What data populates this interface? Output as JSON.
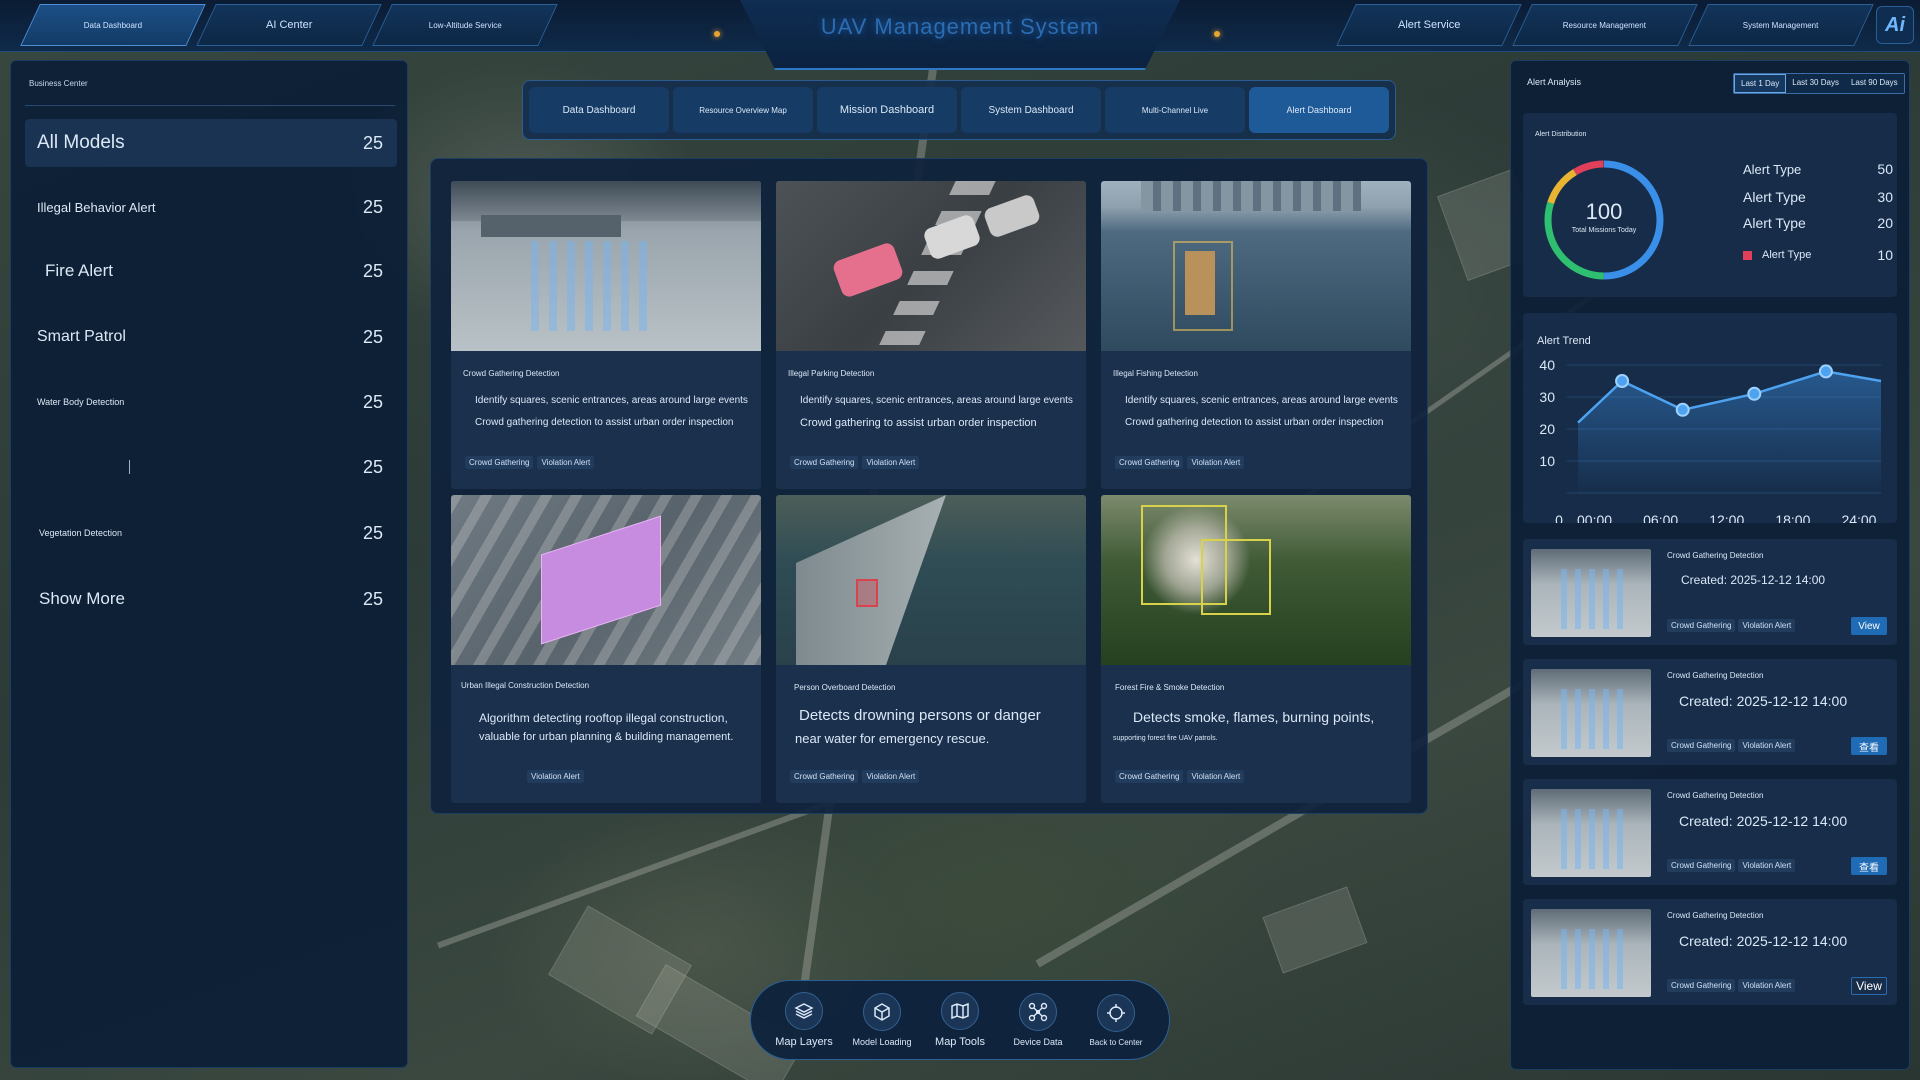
{
  "header": {
    "title": "UAV Management System",
    "left_tabs": [
      {
        "label": "Data Dashboard",
        "active": true
      },
      {
        "label": "AI Center",
        "active": false
      },
      {
        "label": "Low-Altitude Service",
        "active": false
      }
    ],
    "right_tabs": [
      {
        "label": "Alert Service",
        "active": false
      },
      {
        "label": "Resource Management",
        "active": false
      },
      {
        "label": "System Management",
        "active": false
      }
    ],
    "logo_text": "Ai"
  },
  "left_panel": {
    "title": "Business Center",
    "items": [
      {
        "label": "All Models",
        "count": "25"
      },
      {
        "label": "Illegal Behavior Alert",
        "count": "25"
      },
      {
        "label": "Fire Alert",
        "count": "25"
      },
      {
        "label": "Smart Patrol",
        "count": "25"
      },
      {
        "label": "Water Body Detection",
        "count": "25"
      },
      {
        "label": "",
        "count": "25"
      },
      {
        "label": "Vegetation Detection",
        "count": "25"
      },
      {
        "label": "Show More",
        "count": "25"
      }
    ]
  },
  "mid_tabs": [
    {
      "label": "Data Dashboard"
    },
    {
      "label": "Resource Overview Map"
    },
    {
      "label": "Mission Dashboard"
    },
    {
      "label": "System Dashboard"
    },
    {
      "label": "Multi-Channel Live"
    },
    {
      "label": "Alert Dashboard"
    }
  ],
  "cards": [
    {
      "title": "Crowd Gathering Detection",
      "d1": "Identify squares, scenic entrances, areas around large events",
      "d2": "Crowd gathering detection to assist urban order inspection",
      "tags": [
        "Crowd Gathering",
        "Violation Alert"
      ]
    },
    {
      "title": "Illegal Parking Detection",
      "d1": "Identify squares, scenic entrances, areas around large events",
      "d2": "Crowd gathering to assist urban order inspection",
      "tags": [
        "Crowd Gathering",
        "Violation Alert"
      ]
    },
    {
      "title": "Illegal Fishing Detection",
      "d1": "Identify squares, scenic entrances, areas around large events",
      "d2": "Crowd gathering detection to assist urban order inspection",
      "tags": [
        "Crowd Gathering",
        "Violation Alert"
      ]
    },
    {
      "title": "Urban Illegal Construction Detection",
      "d1": "Algorithm detecting rooftop illegal construction,",
      "d2": "valuable for urban planning & building management.",
      "tags": [
        "Violation Alert"
      ]
    },
    {
      "title": "Person Overboard Detection",
      "d1": "Detects drowning persons or danger",
      "d2": "near water for emergency rescue.",
      "tags": [
        "Crowd Gathering",
        "Violation Alert"
      ]
    },
    {
      "title": "Forest Fire & Smoke Detection",
      "d1": "Detects smoke, flames, burning points,",
      "d2": "supporting forest fire UAV patrols.",
      "tags": [
        "Crowd Gathering",
        "Violation Alert"
      ]
    }
  ],
  "right_panel": {
    "title": "Alert Analysis",
    "ranges": [
      {
        "label": "Last 1 Day",
        "active": true
      },
      {
        "label": "Last 30 Days",
        "active": false
      },
      {
        "label": "Last 90 Days",
        "active": false
      }
    ],
    "distribution": {
      "title": "Alert Distribution",
      "total": "100",
      "total_label": "Total Missions Today",
      "legend": [
        {
          "name": "Alert Type",
          "value": "50",
          "color": "#3a8fe8"
        },
        {
          "name": "Alert Type",
          "value": "30",
          "color": "#2fbf71"
        },
        {
          "name": "Alert Type",
          "value": "20",
          "color": "#e8b431"
        },
        {
          "name": "Alert Type",
          "value": "10",
          "color": "#e0405a"
        }
      ]
    },
    "alerts": [
      {
        "title": "Crowd Gathering Detection",
        "created": "Created: 2025-12-12 14:00",
        "tags": [
          "Crowd Gathering",
          "Violation Alert"
        ],
        "btn": "View",
        "btn_style": "filled"
      },
      {
        "title": "Crowd Gathering Detection",
        "created": "Created: 2025-12-12 14:00",
        "tags": [
          "Crowd Gathering",
          "Violation Alert"
        ],
        "btn": "查看",
        "btn_style": "filled"
      },
      {
        "title": "Crowd Gathering Detection",
        "created": "Created: 2025-12-12 14:00",
        "tags": [
          "Crowd Gathering",
          "Violation Alert"
        ],
        "btn": "查看",
        "btn_style": "filled"
      },
      {
        "title": "Crowd Gathering Detection",
        "created": "Created: 2025-12-12 14:00",
        "tags": [
          "Crowd Gathering",
          "Violation Alert"
        ],
        "btn": "View",
        "btn_style": "outline"
      }
    ]
  },
  "chart_data": {
    "type": "line",
    "title": "Alert Trend",
    "x": [
      "00:00",
      "06:00",
      "12:00",
      "18:00",
      "24:00"
    ],
    "x_positions": [
      0,
      6,
      12,
      18,
      24
    ],
    "xlim": [
      -2.5,
      26
    ],
    "y_ticks": [
      "0",
      "10",
      "20",
      "30",
      "40"
    ],
    "ylim": [
      0,
      40
    ],
    "points": [
      [
        -1.5,
        22
      ],
      [
        2.5,
        35
      ],
      [
        8,
        26
      ],
      [
        14.5,
        31
      ],
      [
        21,
        38
      ],
      [
        26,
        35
      ]
    ]
  },
  "toolbar": [
    {
      "label": "Map Layers",
      "icon": "layers-icon"
    },
    {
      "label": "Model Loading",
      "icon": "cube-icon"
    },
    {
      "label": "Map Tools",
      "icon": "map-icon"
    },
    {
      "label": "Device Data",
      "icon": "drone-icon"
    },
    {
      "label": "Back to Center",
      "icon": "target-icon"
    }
  ]
}
